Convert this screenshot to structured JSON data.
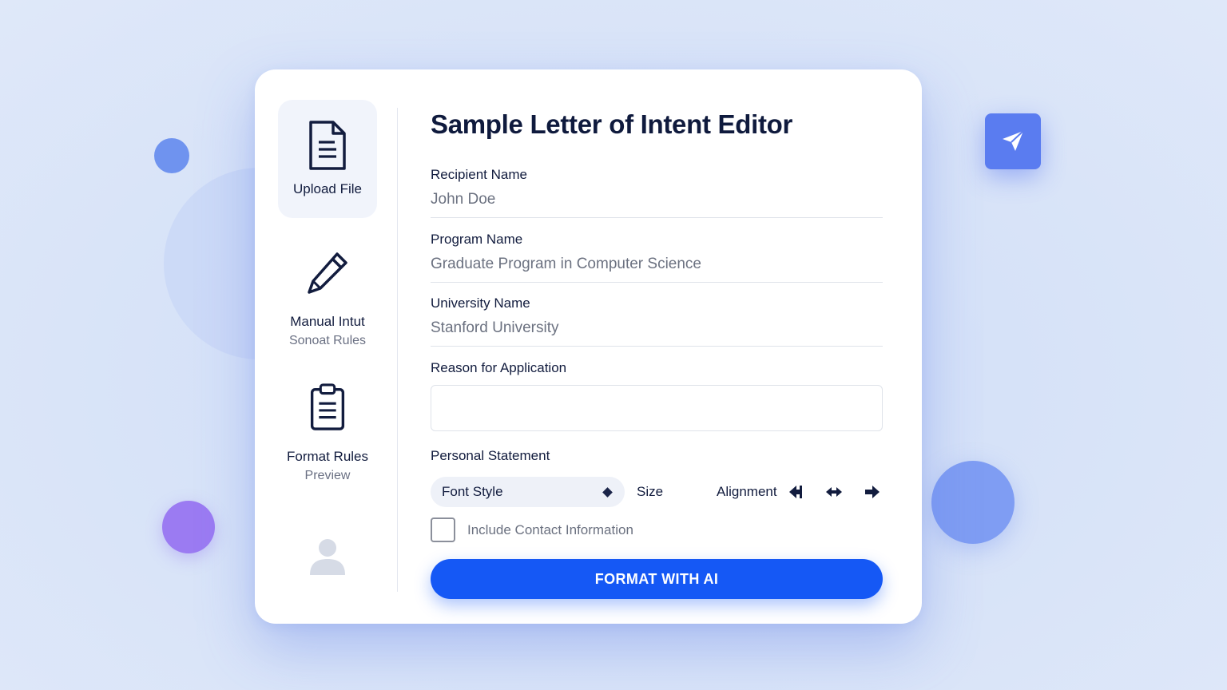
{
  "window": {
    "title": "Sample Letter of Intent Editor"
  },
  "sidebar": {
    "items": [
      {
        "label": "Upload File",
        "icon": "document-icon",
        "active": true
      },
      {
        "label": "Manual Intut",
        "sub": "Sonoat Rules",
        "icon": "pencil-icon"
      },
      {
        "label": "Format Rules",
        "sub": "Preview",
        "icon": "clipboard-icon"
      }
    ],
    "avatar_icon": "user-avatar-icon"
  },
  "form": {
    "recipient": {
      "label": "Recipient Name",
      "value": "John Doe"
    },
    "program": {
      "label": "Program Name",
      "value": "Graduate Program in Computer Science"
    },
    "university": {
      "label": "University Name",
      "value": "Stanford University"
    },
    "reason": {
      "label": "Reason for Application",
      "value": ""
    },
    "personal": {
      "label": "Personal Statement"
    }
  },
  "toolbar": {
    "font_style": "Font Style",
    "size_label": "Size",
    "alignment_label": "Alignment",
    "alignment_icons": [
      "align-left-icon",
      "align-center-icon",
      "align-right-icon"
    ]
  },
  "contact_checkbox": {
    "label": "Include Contact Information",
    "checked": false
  },
  "cta": {
    "label": "FORMAT WITH AI"
  },
  "floating": {
    "send_icon": "send-icon"
  },
  "colors": {
    "accent": "#1558f5",
    "text_dark": "#0f1a3d",
    "muted": "#6b7180",
    "send_tile": "#5a7cf0",
    "purple_dot": "#9b7bf2",
    "blue_dot": "#7f9df3",
    "background": "#d6e2f8"
  }
}
